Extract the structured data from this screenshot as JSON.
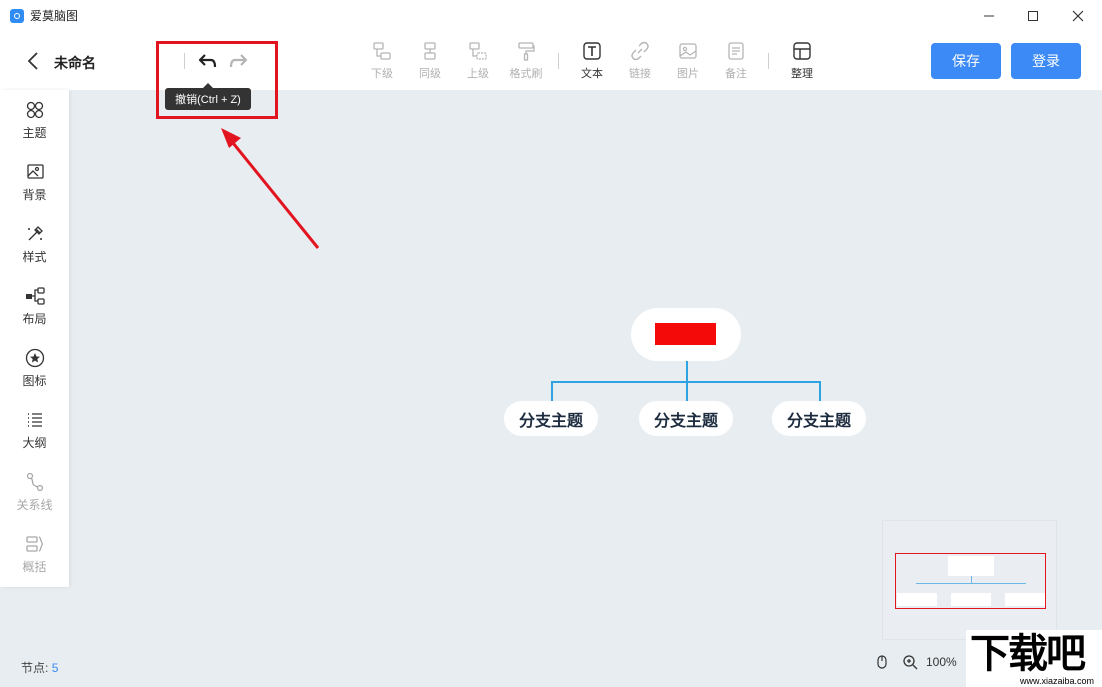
{
  "app": {
    "title": "爱莫脑图"
  },
  "toolbar": {
    "doc_name": "未命名",
    "tooltip": "撤销(Ctrl + Z)",
    "buttons": [
      {
        "label": "下级",
        "enabled": false
      },
      {
        "label": "同级",
        "enabled": false
      },
      {
        "label": "上级",
        "enabled": false
      },
      {
        "label": "格式刷",
        "enabled": false
      },
      {
        "label": "文本",
        "enabled": true
      },
      {
        "label": "链接",
        "enabled": false
      },
      {
        "label": "图片",
        "enabled": false
      },
      {
        "label": "备注",
        "enabled": false
      },
      {
        "label": "整理",
        "enabled": true
      }
    ],
    "save_label": "保存",
    "login_label": "登录"
  },
  "sidebar": {
    "items": [
      {
        "label": "主题",
        "icon": "theme-icon",
        "enabled": true
      },
      {
        "label": "背景",
        "icon": "background-icon",
        "enabled": true
      },
      {
        "label": "样式",
        "icon": "style-icon",
        "enabled": true
      },
      {
        "label": "布局",
        "icon": "layout-icon",
        "enabled": true
      },
      {
        "label": "图标",
        "icon": "star-icon",
        "enabled": true
      },
      {
        "label": "大纲",
        "icon": "outline-icon",
        "enabled": true
      },
      {
        "label": "关系线",
        "icon": "relation-line-icon",
        "enabled": false
      },
      {
        "label": "概括",
        "icon": "summary-icon",
        "enabled": false
      }
    ]
  },
  "mindmap": {
    "root_color": "#f50a0a",
    "branches": [
      "分支主题",
      "分支主题",
      "分支主题"
    ],
    "line_color": "#2fa3e0"
  },
  "status": {
    "nodes_label": "节点:",
    "nodes_count": "5",
    "zoom": "100%"
  },
  "watermark": {
    "main": "下载吧",
    "sub": "www.xiazaiba.com"
  },
  "colors": {
    "accent": "#3c8af6",
    "highlight": "#e2141f"
  }
}
